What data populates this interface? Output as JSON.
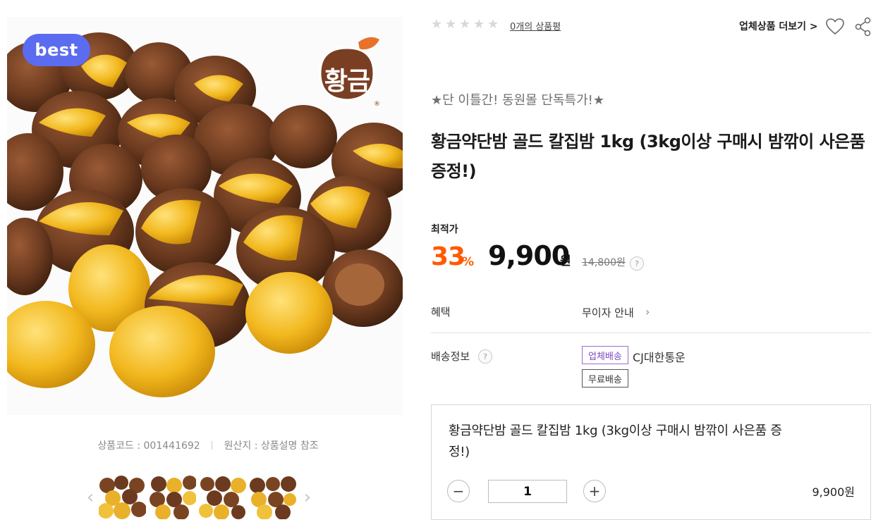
{
  "product_image": {
    "badge": "best",
    "brand_logo_text": "황금"
  },
  "meta": {
    "product_code": "상품코드 : 001441692",
    "origin": "원산지 : 상품설명 참조"
  },
  "gallery": {
    "prev_icon": "‹",
    "next_icon": "›",
    "thumbnail_count": 4
  },
  "rating": {
    "stars_filled": 0,
    "stars_total": 5,
    "review_link": "0개의 상품평"
  },
  "header_actions": {
    "more_link": "업체상품 더보기 >",
    "wishlist_icon": "heart-icon",
    "share_icon": "share-icon"
  },
  "promo": "★단 이틀간! 동원몰 단독특가!★",
  "title": "황금약단밤 골드 칼집밤 1kg (3kg이상 구매시 밤깎이 사은품 증정!)",
  "price": {
    "label": "최적가",
    "discount_percent": "33",
    "discount_unit": "%",
    "sale_price": "9,900",
    "sale_unit": "원",
    "original_price": "14,800원",
    "help_icon": "?"
  },
  "benefits": {
    "label": "혜택",
    "value": "무이자 안내",
    "chevron": "›"
  },
  "shipping": {
    "label": "배송정보",
    "help_icon": "?",
    "tag_vendor": "업체배송",
    "carrier": "CJ대한통운",
    "tag_free": "무료배송"
  },
  "option": {
    "title": "황금약단밤 골드 칼집밤 1kg (3kg이상 구매시 밤깎이 사은품 증정!)",
    "minus": "−",
    "plus": "+",
    "quantity": "1",
    "price": "9,900원"
  },
  "colors": {
    "accent_orange": "#ff5a00",
    "badge_blue": "#5b6cf0",
    "tag_purple": "#7b48c2"
  }
}
